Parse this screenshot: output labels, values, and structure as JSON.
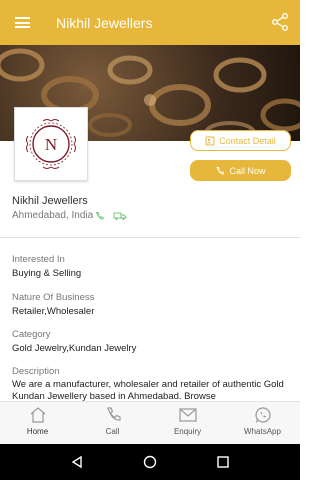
{
  "appbar": {
    "title": "Nikhil Jewellers"
  },
  "logo": {
    "letter": "N"
  },
  "actions": {
    "contact_label": "Contact Detail",
    "call_label": "Call Now"
  },
  "business": {
    "name": "Nikhil Jewellers",
    "location": "Ahmedabad, India"
  },
  "info": [
    {
      "label": "Interested In",
      "value": "Buying & Selling"
    },
    {
      "label": "Nature Of Business",
      "value": "Retailer,Wholesaler"
    },
    {
      "label": "Category",
      "value": "Gold Jewelry,Kundan Jewelry"
    }
  ],
  "description": {
    "label": "Description",
    "text": "We are a manufacturer, wholesaler and retailer of authentic Gold Kundan Jewellery based in Ahmedabad. Browse"
  },
  "bottom_nav": [
    {
      "label": "Home",
      "icon": "home-icon"
    },
    {
      "label": "Call",
      "icon": "phone-icon"
    },
    {
      "label": "Enquiry",
      "icon": "mail-icon"
    },
    {
      "label": "WhatsApp",
      "icon": "whatsapp-icon"
    }
  ],
  "colors": {
    "accent": "#e6b73a",
    "logo_maroon": "#7a1f2b"
  }
}
